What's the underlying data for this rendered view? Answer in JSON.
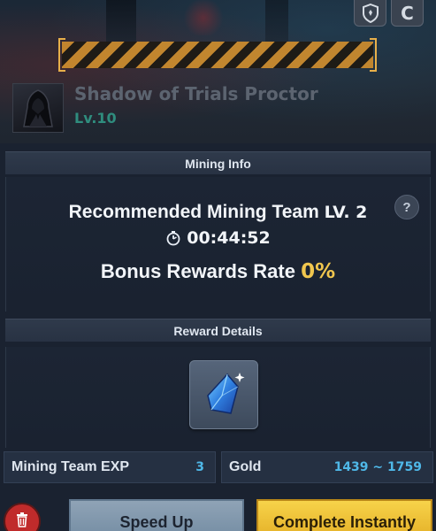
{
  "header": {
    "boss_name": "Shadow of Trials Proctor",
    "boss_level": "Lv.10",
    "icons": [
      "shield-icon",
      "c-icon"
    ],
    "top_button_letter": "C"
  },
  "mining_info": {
    "title": "Mining Info",
    "recommended_label": "Recommended Mining Team",
    "recommended_level": "LV. 2",
    "timer": "00:44:52",
    "bonus_label": "Bonus Rewards Rate",
    "bonus_value": "0%",
    "help_label": "?"
  },
  "reward_details": {
    "title": "Reward Details",
    "item_icon": "blue-crystal-icon"
  },
  "stats": {
    "exp_label": "Mining Team EXP",
    "exp_value": "3",
    "gold_label": "Gold",
    "gold_value": "1439 ~ 1759"
  },
  "actions": {
    "speed_up": "Speed Up",
    "complete": "Complete Instantly",
    "delete_icon": "trash-icon"
  },
  "colors": {
    "accent_gold": "#f0c64e",
    "accent_blue": "#4fb8e8",
    "level_teal": "#2f8d7e",
    "danger_red": "#c02b2b"
  }
}
